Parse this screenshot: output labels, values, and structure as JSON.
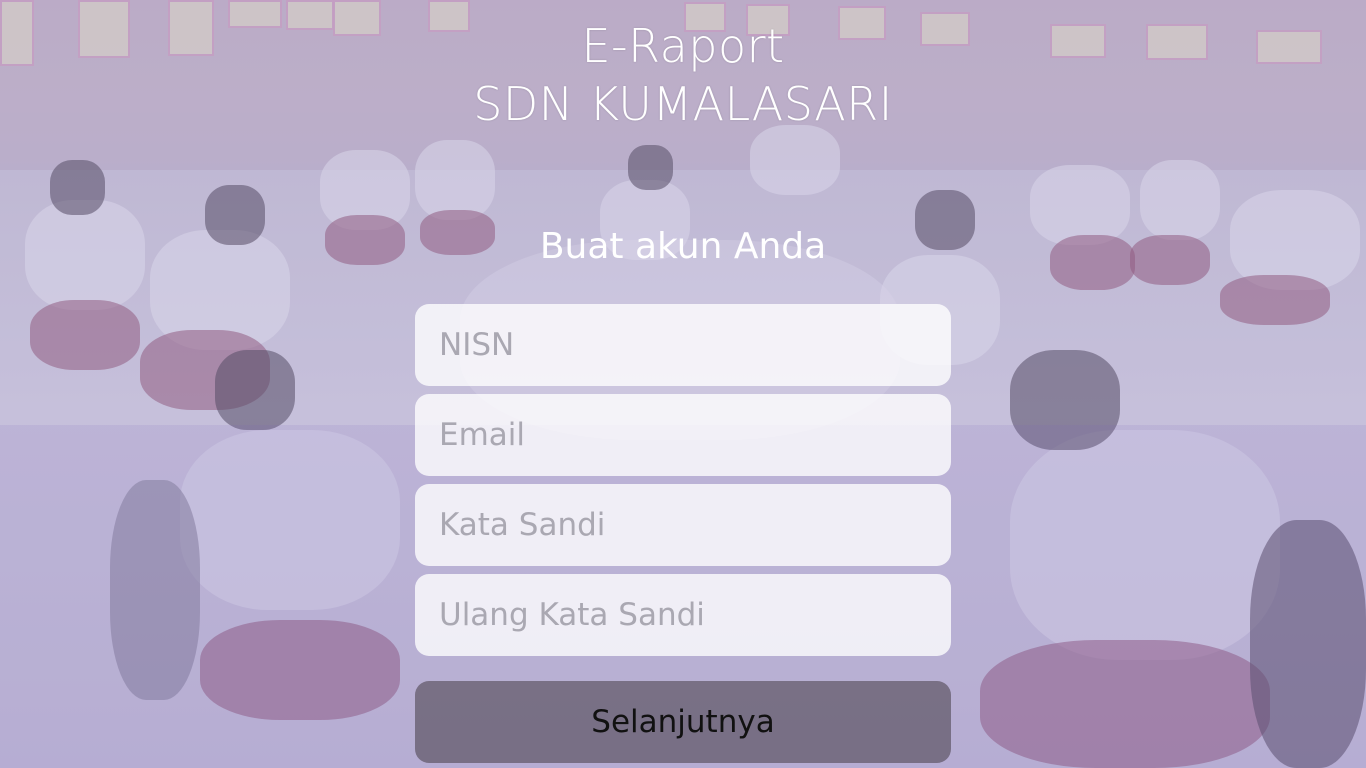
{
  "header": {
    "title_line1": "E-Raport",
    "title_line2": "SDN KUMALASARI"
  },
  "form": {
    "heading": "Buat akun Anda",
    "fields": [
      {
        "placeholder": "NISN",
        "value": ""
      },
      {
        "placeholder": "Email",
        "value": ""
      },
      {
        "placeholder": "Kata Sandi",
        "value": ""
      },
      {
        "placeholder": "Ulang Kata Sandi",
        "value": ""
      }
    ],
    "submit_label": "Selanjutnya"
  },
  "colors": {
    "overlay": "#9c8fd0",
    "text": "#ffffff",
    "button_bg": "#463c46"
  }
}
